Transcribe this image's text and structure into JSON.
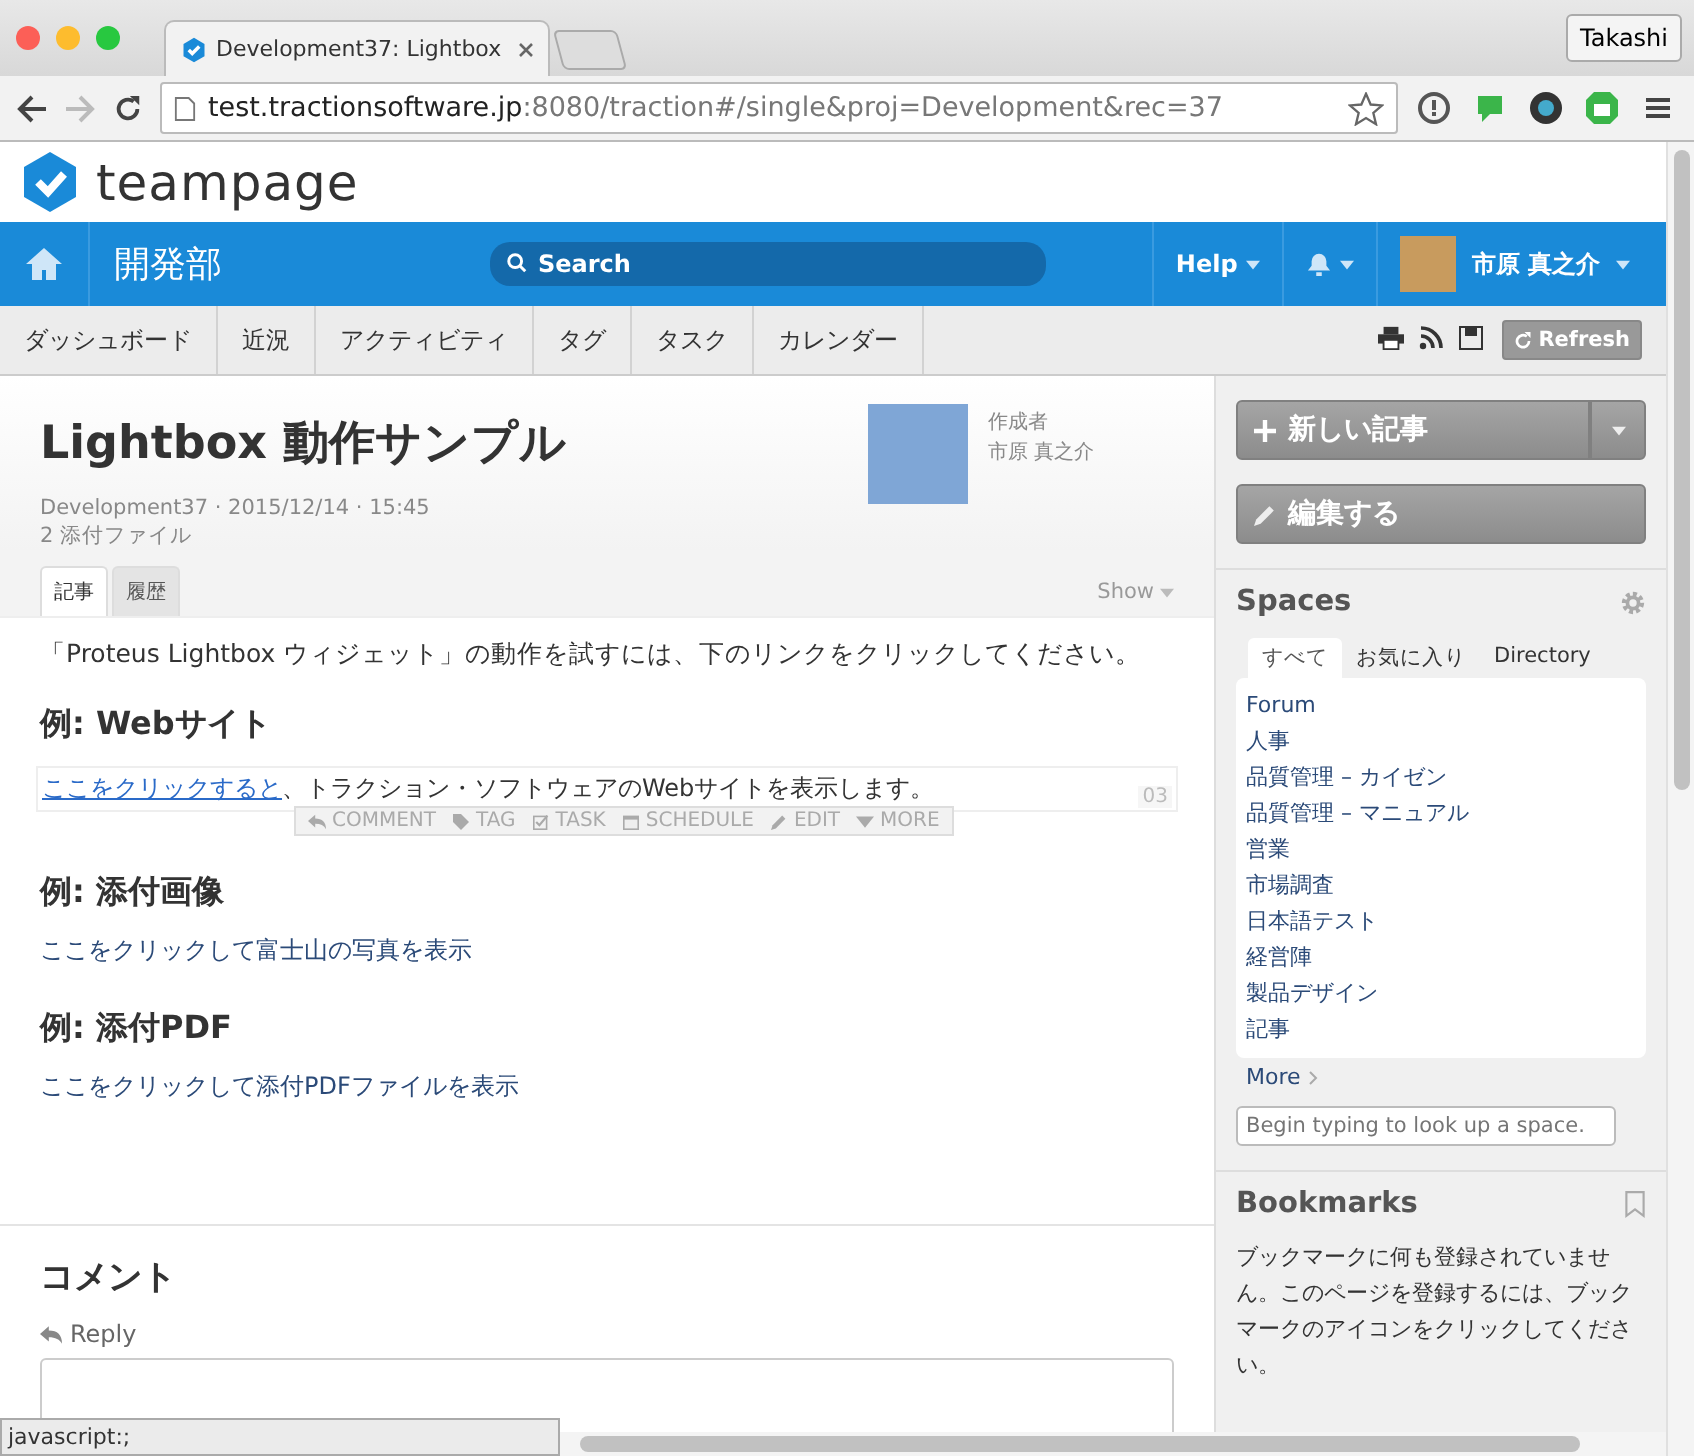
{
  "browser": {
    "tabs": [
      {
        "title": "Development37: Lightbox",
        "selected": true
      }
    ],
    "profile": "Takashi",
    "address": {
      "host": "test.tractionsoftware.jp",
      "path": ":8080/traction#/single&proj=Development&rec=37"
    }
  },
  "logo": "teampage",
  "topbar": {
    "space": "開発部",
    "search_placeholder": "Search",
    "help": "Help",
    "user": "市原 真之介"
  },
  "subnav": [
    {
      "label": "ダッシュボード"
    },
    {
      "label": "近況"
    },
    {
      "label": "アクティビティ"
    },
    {
      "label": "タグ"
    },
    {
      "label": "タスク"
    },
    {
      "label": "カレンダー"
    }
  ],
  "refresh": "Refresh",
  "article": {
    "title": "Lightbox 動作サンプル",
    "meta": "Development37 · 2015/12/14 · 15:45",
    "attachments": "2 添付ファイル",
    "author_label": "作成者",
    "author": "市原 真之介",
    "tabs": [
      {
        "label": "記事",
        "selected": true
      },
      {
        "label": "履歴",
        "selected": false
      }
    ],
    "show": "Show",
    "intro": "「Proteus Lightbox ウィジェット」の動作を試すには、下のリンクをクリックしてください。",
    "sections": [
      {
        "heading": "例: Webサイト",
        "link": "ここをクリックすると",
        "text": "、トラクション・ソフトウェアのWebサイトを表示します。",
        "paragraph_number": "03",
        "actions": [
          {
            "kind": "comment",
            "label": "COMMENT"
          },
          {
            "kind": "tag",
            "label": "TAG"
          },
          {
            "kind": "task",
            "label": "TASK"
          },
          {
            "kind": "schedule",
            "label": "SCHEDULE"
          },
          {
            "kind": "edit",
            "label": "EDIT"
          },
          {
            "kind": "more",
            "label": "MORE"
          }
        ]
      },
      {
        "heading": "例: 添付画像",
        "link": "ここをクリックして富士山の写真を表示"
      },
      {
        "heading": "例: 添付PDF",
        "link": "ここをクリックして添付PDFファイルを表示"
      }
    ]
  },
  "comments": {
    "heading": "コメント",
    "reply": "Reply"
  },
  "sidebar": {
    "new_article": "新しい記事",
    "edit": "編集する",
    "spaces_title": "Spaces",
    "space_tabs": [
      {
        "label": "すべて",
        "selected": true
      },
      {
        "label": "お気に入り",
        "selected": false
      },
      {
        "label": "Directory",
        "selected": false
      }
    ],
    "spaces": [
      "Forum",
      "人事",
      "品質管理 – カイゼン",
      "品質管理 – マニュアル",
      "営業",
      "市場調査",
      "日本語テスト",
      "経営陣",
      "製品デザイン",
      "記事"
    ],
    "more": "More",
    "lookup_placeholder": "Begin typing to look up a space.",
    "bookmarks_title": "Bookmarks",
    "bookmarks_text": "ブックマークに何も登録されていません。このページを登録するには、ブックマークのアイコンをクリックしてください。"
  },
  "status_bar": "javascript:;"
}
